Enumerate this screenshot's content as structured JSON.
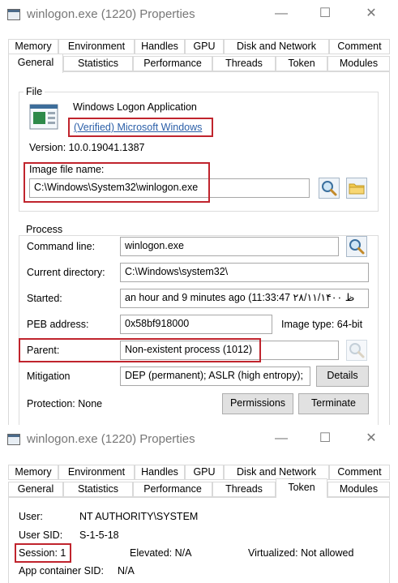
{
  "window1": {
    "title": "winlogon.exe (1220) Properties",
    "controls": {
      "minimize": "—",
      "maximize": "☐",
      "close": "✕"
    },
    "tabs_row1": [
      "Memory",
      "Environment",
      "Handles",
      "GPU",
      "Disk and Network",
      "Comment"
    ],
    "tabs_row2": [
      "General",
      "Statistics",
      "Performance",
      "Threads",
      "Token",
      "Modules"
    ],
    "active_tab": "General",
    "file": {
      "group_label": "File",
      "app_name": "Windows Logon Application",
      "verified_link": "(Verified) Microsoft Windows",
      "version": "Version: 10.0.19041.1387",
      "image_label": "Image file name:",
      "image_path": "C:\\Windows\\System32\\winlogon.exe"
    },
    "process": {
      "group_label": "Process",
      "command_line_label": "Command line:",
      "command_line_value": "winlogon.exe",
      "current_dir_label": "Current directory:",
      "current_dir_value": "C:\\Windows\\system32\\",
      "started_label": "Started:",
      "started_value": "an hour and 9 minutes ago (11:33:47 ۲۸/۱۱/۱۴۰۰ ظ",
      "peb_label": "PEB address:",
      "peb_value": "0x58bf918000",
      "image_type": "Image type:  64-bit",
      "parent_label": "Parent:",
      "parent_value": "Non-existent process (1012)",
      "mitigation_label": "Mitigation",
      "mitigation_value": "DEP (permanent); ASLR (high entropy);",
      "details_button": "Details",
      "protection": "Protection:  None",
      "permissions_button": "Permissions",
      "terminate_button": "Terminate"
    }
  },
  "window2": {
    "title": "winlogon.exe (1220) Properties",
    "controls": {
      "minimize": "—",
      "maximize": "☐",
      "close": "✕"
    },
    "tabs_row1": [
      "Memory",
      "Environment",
      "Handles",
      "GPU",
      "Disk and Network",
      "Comment"
    ],
    "tabs_row2": [
      "General",
      "Statistics",
      "Performance",
      "Threads",
      "Token",
      "Modules"
    ],
    "active_tab": "Token",
    "token": {
      "user_label": "User:",
      "user_value": "NT AUTHORITY\\SYSTEM",
      "sid_label": "User SID:",
      "sid_value": "S-1-5-18",
      "session": "Session: 1",
      "elevated": "Elevated:  N/A",
      "virtualized": "Virtualized:  Not allowed",
      "app_container_label": "App container SID:",
      "app_container_value": "N/A"
    }
  },
  "colors": {
    "highlight_red": "#c0242d",
    "link_blue": "#2b5fa8",
    "disabled_grey": "#777777"
  },
  "icons": [
    "app-window-icon",
    "winlogon-file-icon",
    "search-icon",
    "folder-icon"
  ]
}
